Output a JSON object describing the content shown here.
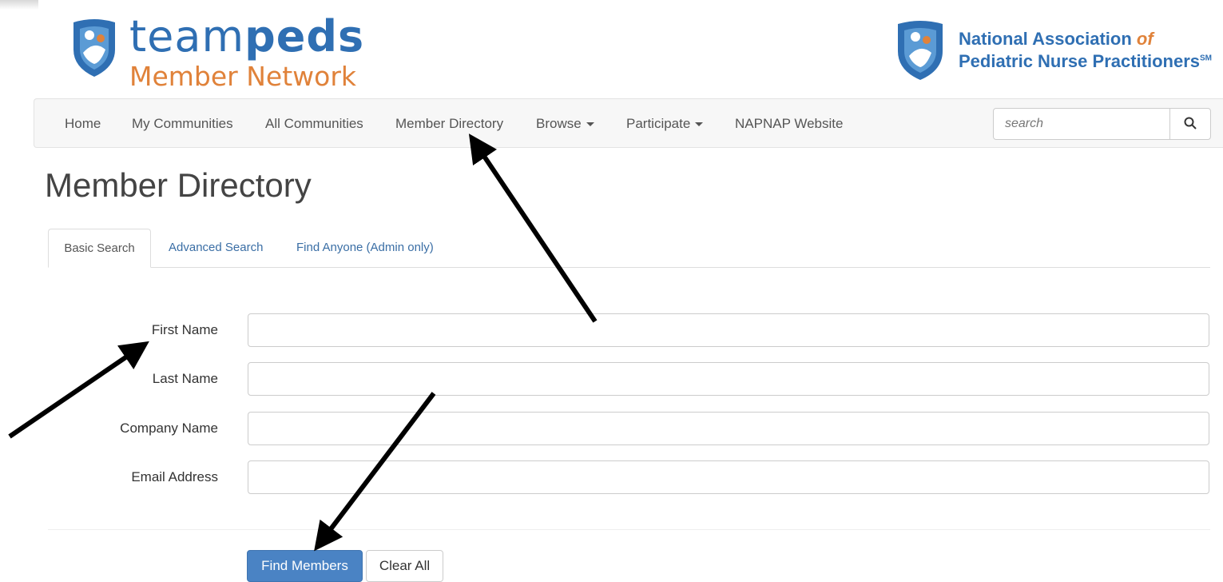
{
  "header": {
    "logo_team_light": "team",
    "logo_team_bold": "peds",
    "logo_subtitle": "Member Network",
    "org_line1": "National Association",
    "org_line1_of": "of",
    "org_line2": "Pediatric Nurse Practitioners",
    "org_line2_mark": "SM"
  },
  "nav": {
    "items": [
      {
        "label": "Home"
      },
      {
        "label": "My Communities"
      },
      {
        "label": "All Communities"
      },
      {
        "label": "Member Directory"
      },
      {
        "label": "Browse"
      },
      {
        "label": "Participate"
      },
      {
        "label": "NAPNAP Website"
      }
    ],
    "search_placeholder": "search",
    "search_icon": "search-icon"
  },
  "page": {
    "title": "Member Directory",
    "tabs": [
      {
        "label": "Basic Search",
        "active": true
      },
      {
        "label": "Advanced Search",
        "active": false
      },
      {
        "label": "Find Anyone (Admin only)",
        "active": false
      }
    ],
    "fields": [
      {
        "label": "First Name",
        "value": ""
      },
      {
        "label": "Last Name",
        "value": ""
      },
      {
        "label": "Company Name",
        "value": ""
      },
      {
        "label": "Email Address",
        "value": ""
      }
    ],
    "find_button": "Find Members",
    "clear_button": "Clear All"
  },
  "colors": {
    "brand_blue": "#2f6fb3",
    "brand_orange": "#e0823a",
    "primary_button": "#4a83c4",
    "tab_link": "#3a6ea5"
  }
}
